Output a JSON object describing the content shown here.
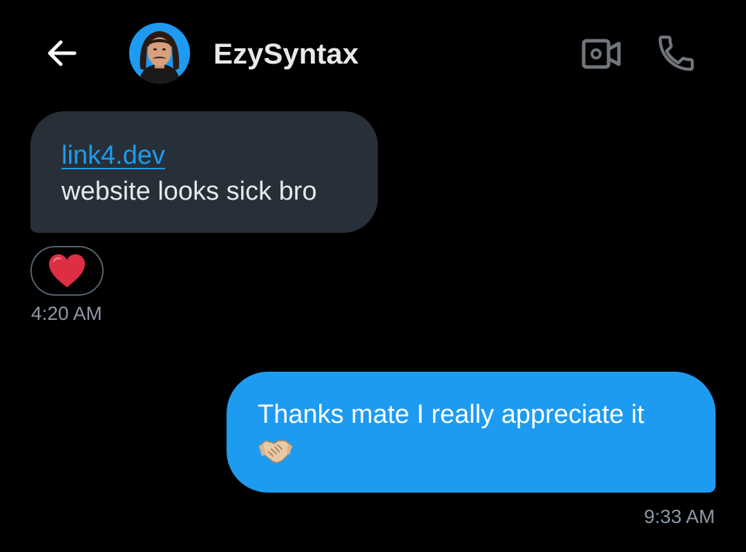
{
  "header": {
    "contact_name": "EzySyntax",
    "back_icon": "arrow-left-icon",
    "video_icon": "video-camera-icon",
    "call_icon": "phone-icon"
  },
  "messages": [
    {
      "direction": "incoming",
      "link_text": "link4.dev",
      "text": "website looks sick bro",
      "reaction": "heart-emoji",
      "time": "4:20 AM"
    },
    {
      "direction": "outgoing",
      "text": "Thanks mate I really appreciate it",
      "emoji": "handshake-emoji",
      "time": "9:33 AM"
    }
  ],
  "colors": {
    "background": "#000000",
    "incoming_bubble": "#273038",
    "outgoing_bubble": "#1d9bf0",
    "link": "#1d9bf0",
    "timestamp": "#8b98a5",
    "text": "#e7e9ea"
  }
}
